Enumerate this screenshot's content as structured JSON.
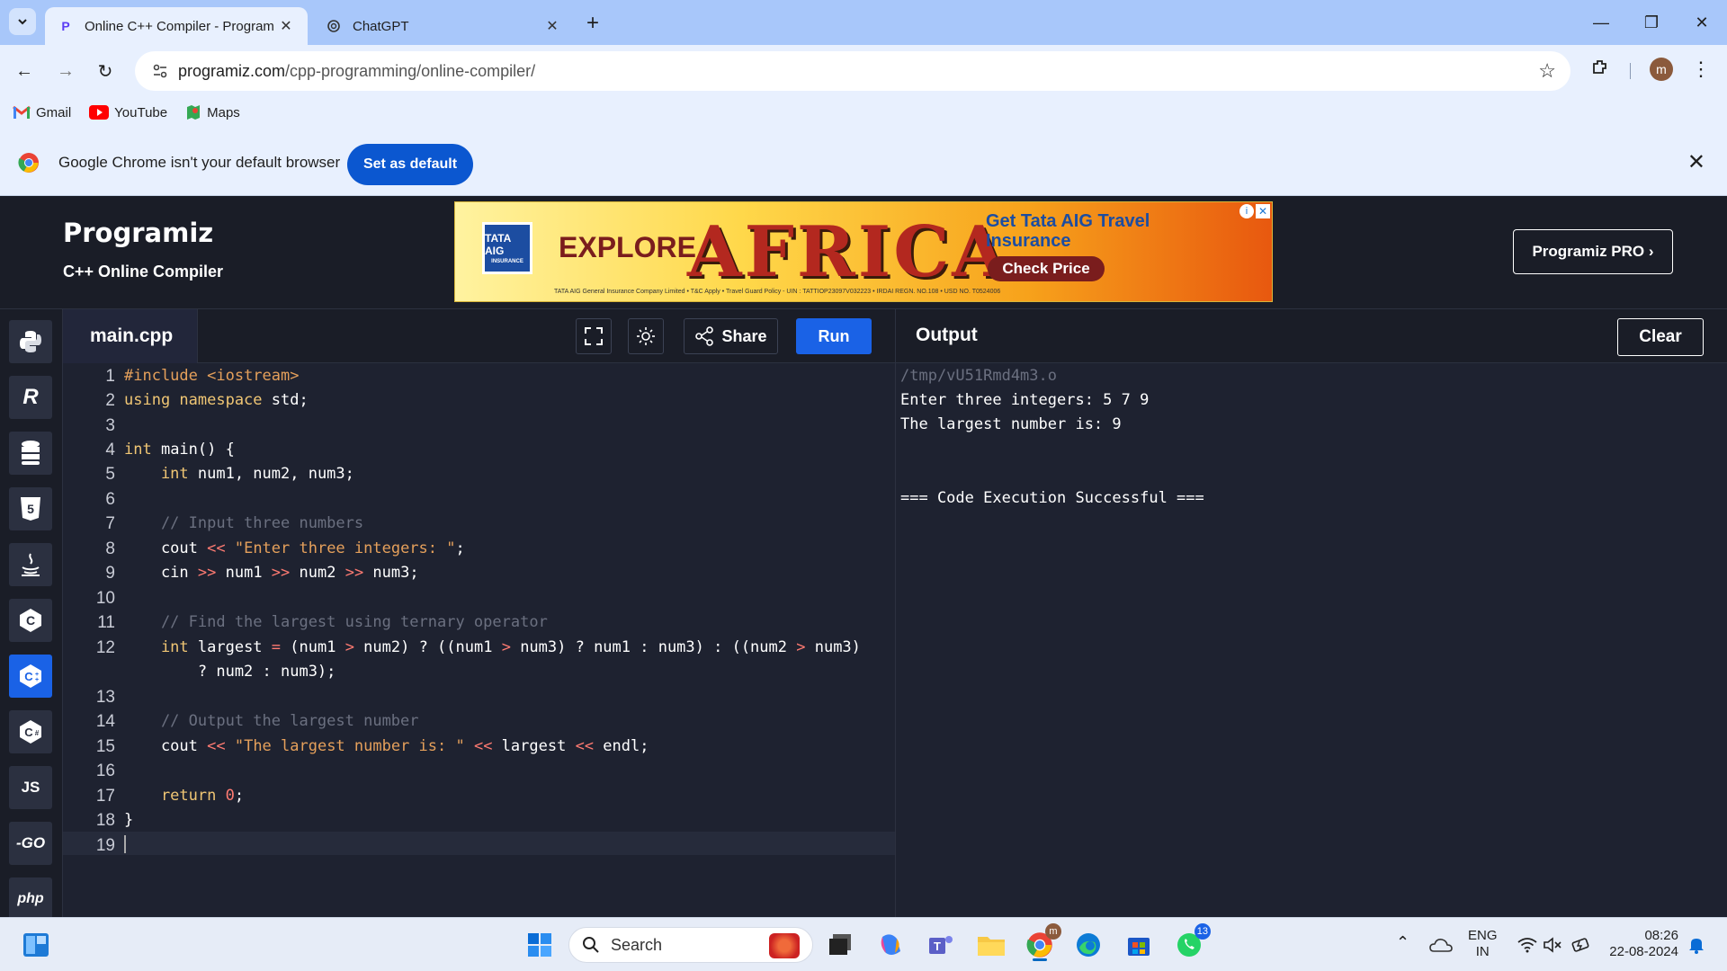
{
  "browser": {
    "tabs": [
      {
        "title": "Online C++ Compiler - Program",
        "active": true
      },
      {
        "title": "ChatGPT",
        "active": false
      }
    ],
    "url_host": "programiz.com",
    "url_path": "/cpp-programming/online-compiler/",
    "profile_initial": "m",
    "bookmarks": [
      {
        "label": "Gmail",
        "icon": "gmail-icon"
      },
      {
        "label": "YouTube",
        "icon": "youtube-icon"
      },
      {
        "label": "Maps",
        "icon": "maps-icon"
      }
    ],
    "infobar": {
      "message": "Google Chrome isn't your default browser",
      "button": "Set as default"
    }
  },
  "site": {
    "logo": "Programiz",
    "subtitle": "C++ Online Compiler",
    "pro_button": "Programiz PRO ›",
    "ad": {
      "brand": "TATA AIG",
      "brand_tagline": "INSURANCE",
      "headline": "EXPLORE",
      "big_word": "AFRICA",
      "offer": "Get Tata AIG Travel Insurance",
      "cta": "Check Price",
      "fine_print": "TATA AIG General Insurance Company Limited • T&C Apply • Travel Guard Policy - UIN : TATTIOP23097V032223 • IRDAI REGN. NO.108 • USD NO. T0524006"
    }
  },
  "languages": [
    {
      "name": "python-icon",
      "label": "Py"
    },
    {
      "name": "r-icon",
      "label": "R"
    },
    {
      "name": "sql-icon",
      "label": "SQL"
    },
    {
      "name": "html-icon",
      "label": "5"
    },
    {
      "name": "java-icon",
      "label": "J"
    },
    {
      "name": "c-icon",
      "label": "C"
    },
    {
      "name": "cpp-icon",
      "label": "C"
    },
    {
      "name": "csharp-icon",
      "label": "C"
    },
    {
      "name": "js-icon",
      "label": "JS"
    },
    {
      "name": "go-icon",
      "label": "GO"
    },
    {
      "name": "php-icon",
      "label": "php"
    }
  ],
  "editor": {
    "file_name": "main.cpp",
    "share_label": "Share",
    "run_label": "Run",
    "line_numbers": [
      "1",
      "2",
      "3",
      "4",
      "5",
      "6",
      "7",
      "8",
      "9",
      "10",
      "11",
      "12",
      "13",
      "14",
      "15",
      "16",
      "17",
      "18",
      "19"
    ],
    "code": {
      "l1a": "#include ",
      "l1b": "<iostream>",
      "l2a": "using namespace ",
      "l2b": "std;",
      "l4a": "int ",
      "l4b": "main() {",
      "l5a": "    int ",
      "l5b": "num1, num2, num3;",
      "l7": "    // Input three numbers",
      "l8a": "    cout ",
      "l8b": "<< ",
      "l8c": "\"Enter three integers: \"",
      "l8d": ";",
      "l9a": "    cin ",
      "l9b": ">> ",
      "l9c": "num1 ",
      "l9d": ">> ",
      "l9e": "num2 ",
      "l9f": ">> ",
      "l9g": "num3;",
      "l11": "    // Find the largest using ternary operator",
      "l12a": "    int ",
      "l12b": "largest ",
      "l12c": "= ",
      "l12d": "(num1 ",
      "l12e": "> ",
      "l12f": "num2) ? ((num1 ",
      "l12g": "> ",
      "l12h": "num3) ? num1 : num3) : ((num2 ",
      "l12i": "> ",
      "l12j": "num3)",
      "l12k": "        ? num2 : num3);",
      "l14": "    // Output the largest number",
      "l15a": "    cout ",
      "l15b": "<< ",
      "l15c": "\"The largest number is: \" ",
      "l15d": "<< ",
      "l15e": "largest ",
      "l15f": "<< ",
      "l15g": "endl;",
      "l17a": "    return ",
      "l17b": "0",
      "l17c": ";",
      "l18": "}"
    }
  },
  "output": {
    "title": "Output",
    "clear_label": "Clear",
    "lines": [
      "/tmp/vU51Rmd4m3.o",
      "Enter three integers: 5 7 9",
      "The largest number is: 9",
      "=== Code Execution Successful ==="
    ]
  },
  "taskbar": {
    "search_label": "Search",
    "lang_line1": "ENG",
    "lang_line2": "IN",
    "time": "08:26",
    "date": "22-08-2024",
    "whatsapp_badge": "13",
    "chrome_profile": "m"
  },
  "colors": {
    "accent": "#1a62e6",
    "editor_bg": "#1e2230",
    "header_bg": "#1a1d27",
    "keyword": "#f0c674",
    "string": "#e5a05b",
    "operator": "#ff7b72",
    "comment": "#6b7080"
  }
}
